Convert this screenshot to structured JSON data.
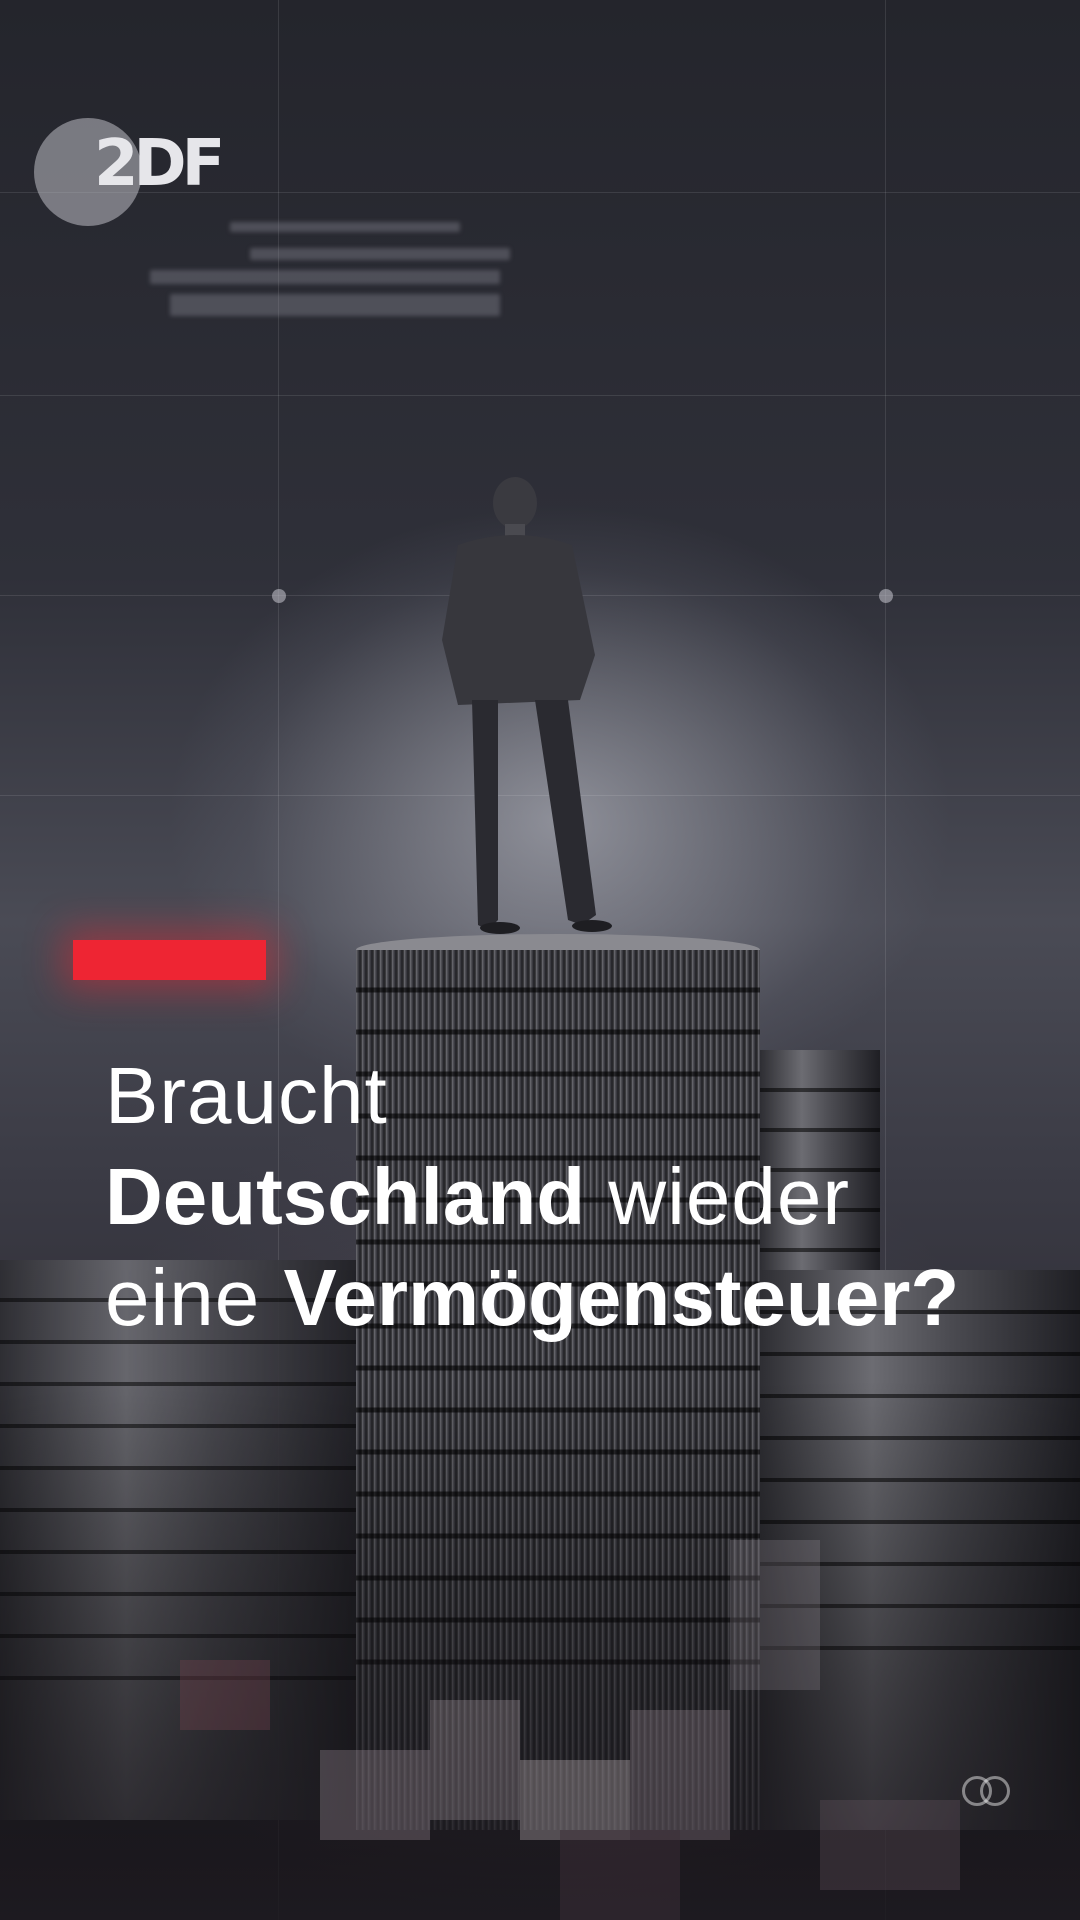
{
  "brand": {
    "logo_text": "2DF"
  },
  "headline": {
    "line1": "Braucht",
    "line2_bold": "Deutschland",
    "line2_rest": "wieder",
    "line3_prefix": "eine",
    "line3_bold": "Vermögensteuer?"
  },
  "colors": {
    "accent": "#ee2533",
    "text": "#ffffff",
    "background": "#2a2b33"
  },
  "icons": {
    "bottom_right": "double-circle-icon"
  }
}
